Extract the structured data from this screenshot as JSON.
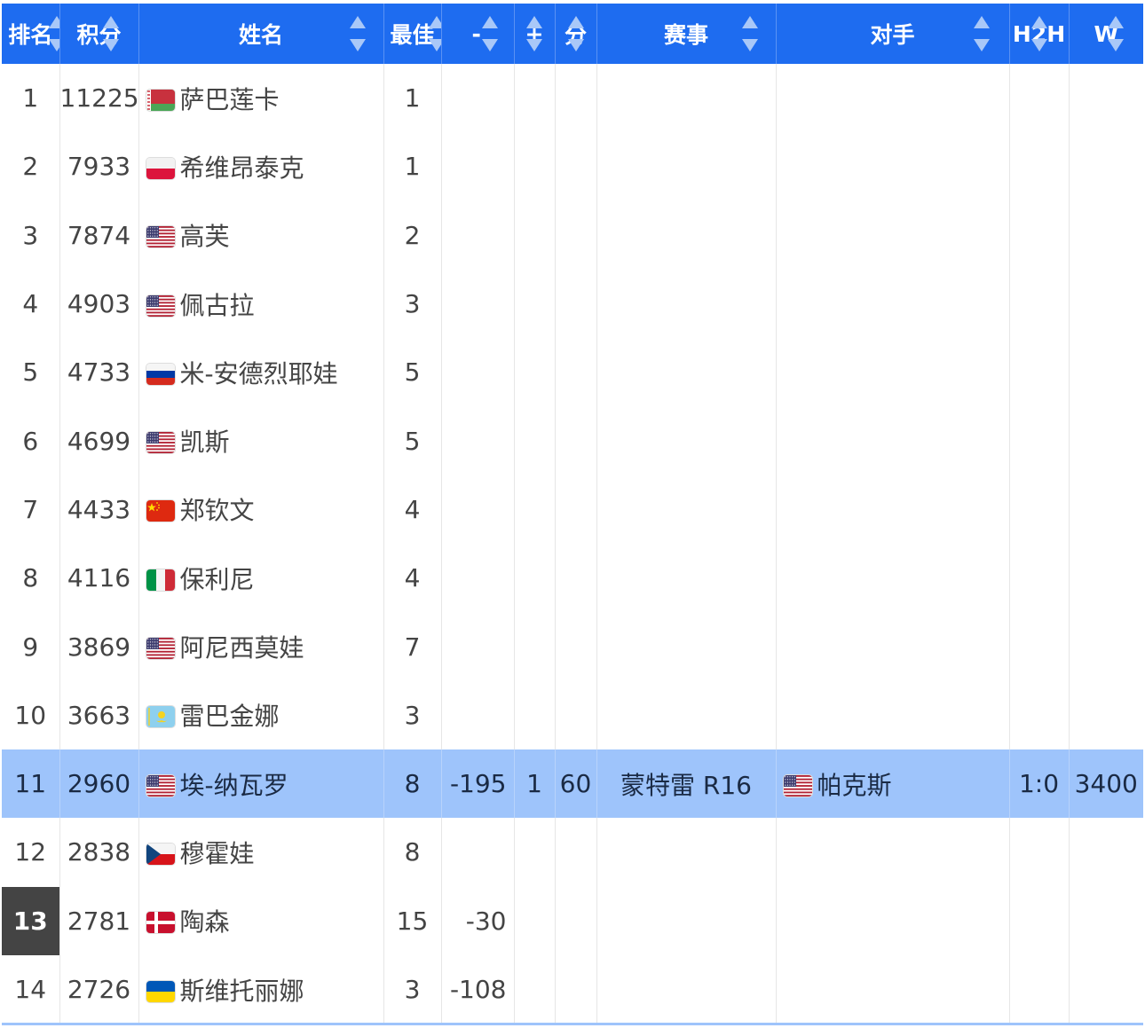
{
  "header": {
    "rank": "排名",
    "points": "积分",
    "name": "姓名",
    "best": "最佳",
    "minus": "-",
    "plus": "+",
    "score": "分",
    "event": "赛事",
    "opponent": "对手",
    "h2h": "H2H",
    "w": "W"
  },
  "flags": {
    "blr": "belarus-flag",
    "pol": "poland-flag",
    "usa": "usa-flag",
    "rus": "russia-flag",
    "chn": "china-flag",
    "ita": "italy-flag",
    "kaz": "kazakhstan-flag",
    "cze": "czech-flag",
    "den": "denmark-flag",
    "ukr": "ukraine-flag"
  },
  "colors": {
    "header_bg": "#1e6cf0",
    "highlight_row": "#9ec4fb",
    "rank_dark": "#444444"
  },
  "rows": [
    {
      "rank": "1",
      "points": "11225",
      "flag": "blr",
      "name": "萨巴莲卡",
      "best": "1",
      "minus": "",
      "plus": "",
      "score": "",
      "event": "",
      "opp_flag": "",
      "opponent": "",
      "h2h": "",
      "w": ""
    },
    {
      "rank": "2",
      "points": "7933",
      "flag": "pol",
      "name": "希维昂泰克",
      "best": "1",
      "minus": "",
      "plus": "",
      "score": "",
      "event": "",
      "opp_flag": "",
      "opponent": "",
      "h2h": "",
      "w": ""
    },
    {
      "rank": "3",
      "points": "7874",
      "flag": "usa",
      "name": "高芙",
      "best": "2",
      "minus": "",
      "plus": "",
      "score": "",
      "event": "",
      "opp_flag": "",
      "opponent": "",
      "h2h": "",
      "w": ""
    },
    {
      "rank": "4",
      "points": "4903",
      "flag": "usa",
      "name": "佩古拉",
      "best": "3",
      "minus": "",
      "plus": "",
      "score": "",
      "event": "",
      "opp_flag": "",
      "opponent": "",
      "h2h": "",
      "w": ""
    },
    {
      "rank": "5",
      "points": "4733",
      "flag": "rus",
      "name": "米-安德烈耶娃",
      "best": "5",
      "minus": "",
      "plus": "",
      "score": "",
      "event": "",
      "opp_flag": "",
      "opponent": "",
      "h2h": "",
      "w": ""
    },
    {
      "rank": "6",
      "points": "4699",
      "flag": "usa",
      "name": "凯斯",
      "best": "5",
      "minus": "",
      "plus": "",
      "score": "",
      "event": "",
      "opp_flag": "",
      "opponent": "",
      "h2h": "",
      "w": ""
    },
    {
      "rank": "7",
      "points": "4433",
      "flag": "chn",
      "name": "郑钦文",
      "best": "4",
      "minus": "",
      "plus": "",
      "score": "",
      "event": "",
      "opp_flag": "",
      "opponent": "",
      "h2h": "",
      "w": ""
    },
    {
      "rank": "8",
      "points": "4116",
      "flag": "ita",
      "name": "保利尼",
      "best": "4",
      "minus": "",
      "plus": "",
      "score": "",
      "event": "",
      "opp_flag": "",
      "opponent": "",
      "h2h": "",
      "w": ""
    },
    {
      "rank": "9",
      "points": "3869",
      "flag": "usa",
      "name": "阿尼西莫娃",
      "best": "7",
      "minus": "",
      "plus": "",
      "score": "",
      "event": "",
      "opp_flag": "",
      "opponent": "",
      "h2h": "",
      "w": ""
    },
    {
      "rank": "10",
      "points": "3663",
      "flag": "kaz",
      "name": "雷巴金娜",
      "best": "3",
      "minus": "",
      "plus": "",
      "score": "",
      "event": "",
      "opp_flag": "",
      "opponent": "",
      "h2h": "",
      "w": ""
    },
    {
      "rank": "11",
      "points": "2960",
      "flag": "usa",
      "name": "埃-纳瓦罗",
      "best": "8",
      "minus": "-195",
      "plus": "1",
      "score": "60",
      "event": "蒙特雷 R16",
      "opp_flag": "usa",
      "opponent": "帕克斯",
      "h2h": "1:0",
      "w": "3400",
      "highlight": true
    },
    {
      "rank": "12",
      "points": "2838",
      "flag": "cze",
      "name": "穆霍娃",
      "best": "8",
      "minus": "",
      "plus": "",
      "score": "",
      "event": "",
      "opp_flag": "",
      "opponent": "",
      "h2h": "",
      "w": ""
    },
    {
      "rank": "13",
      "points": "2781",
      "flag": "den",
      "name": "陶森",
      "best": "15",
      "minus": "-30",
      "plus": "",
      "score": "",
      "event": "",
      "opp_flag": "",
      "opponent": "",
      "h2h": "",
      "w": "",
      "rank_dark": true
    },
    {
      "rank": "14",
      "points": "2726",
      "flag": "ukr",
      "name": "斯维托丽娜",
      "best": "3",
      "minus": "-108",
      "plus": "",
      "score": "",
      "event": "",
      "opp_flag": "",
      "opponent": "",
      "h2h": "",
      "w": ""
    }
  ]
}
